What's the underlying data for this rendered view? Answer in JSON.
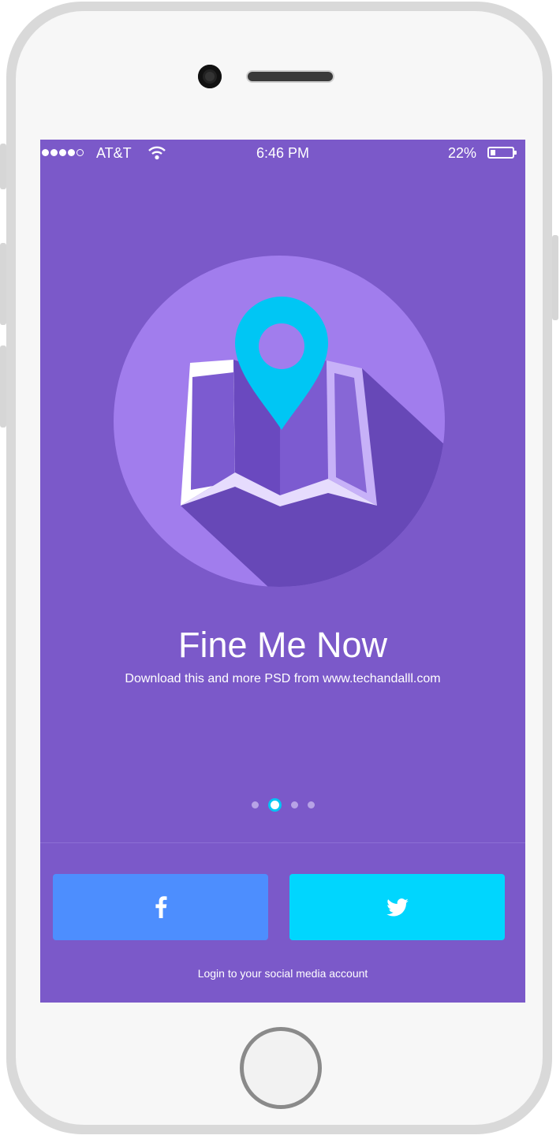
{
  "status_bar": {
    "carrier": "AT&T",
    "time": "6:46 PM",
    "battery_percent": "22%",
    "battery_level": 0.22,
    "signal_bars_filled": 4,
    "signal_bars_total": 5
  },
  "onboarding": {
    "title": "Fine Me Now",
    "subtitle": "Download this and more PSD from www.techandalll.com",
    "page_count": 4,
    "active_page": 2
  },
  "social": {
    "facebook_icon": "facebook-icon",
    "twitter_icon": "twitter-icon",
    "footer": "Login to your social media account"
  },
  "colors": {
    "screen_background": "#7b59c9",
    "circle": "#a17ded",
    "shadow": "#6748b7",
    "pin": "#00c6f4",
    "facebook": "#4d8efe",
    "twitter": "#00d6fe"
  }
}
